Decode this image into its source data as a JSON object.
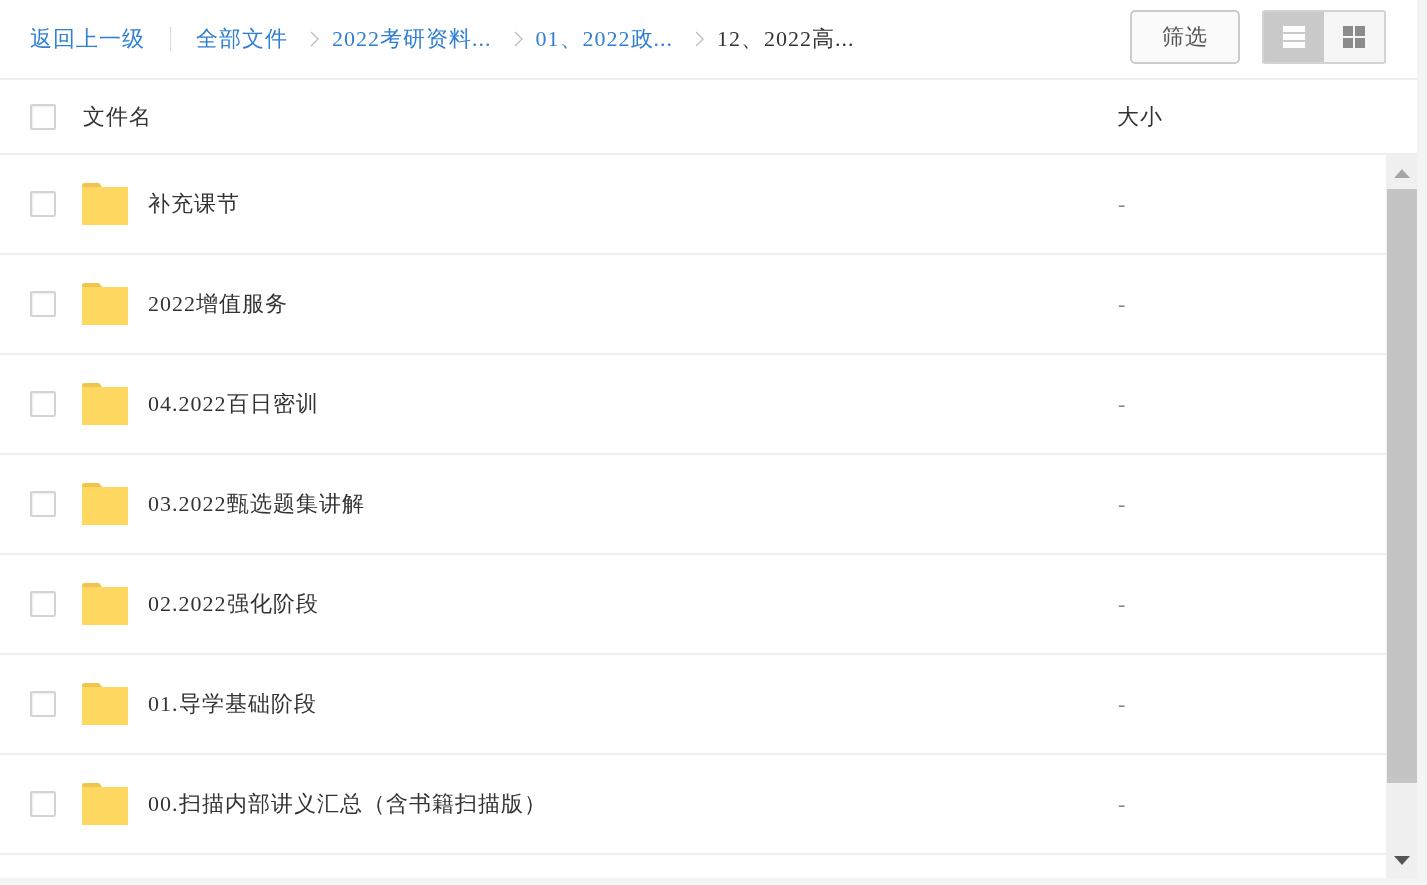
{
  "toolbar": {
    "back_link": "返回上一级",
    "breadcrumbs": [
      {
        "label": "全部文件",
        "current": false
      },
      {
        "label": "2022考研资料...",
        "current": false
      },
      {
        "label": "01、2022政...",
        "current": false
      },
      {
        "label": "12、2022高...",
        "current": true
      }
    ],
    "filter_button": "筛选",
    "view_modes": [
      {
        "kind": "list",
        "selected": true
      },
      {
        "kind": "grid",
        "selected": false
      }
    ]
  },
  "table": {
    "select_all": {
      "checked": false
    },
    "columns": [
      "文件名",
      "大小"
    ],
    "rows": [
      {
        "kind": "folder",
        "name": "补充课节",
        "size": "-",
        "checked": false
      },
      {
        "kind": "folder",
        "name": "2022增值服务",
        "size": "-",
        "checked": false
      },
      {
        "kind": "folder",
        "name": "04.2022百日密训",
        "size": "-",
        "checked": false
      },
      {
        "kind": "folder",
        "name": "03.2022甄选题集讲解",
        "size": "-",
        "checked": false
      },
      {
        "kind": "folder",
        "name": "02.2022强化阶段",
        "size": "-",
        "checked": false
      },
      {
        "kind": "folder",
        "name": "01.导学基础阶段",
        "size": "-",
        "checked": false
      },
      {
        "kind": "folder",
        "name": "00.扫描内部讲义汇总（含书籍扫描版）",
        "size": "-",
        "checked": false
      }
    ]
  }
}
